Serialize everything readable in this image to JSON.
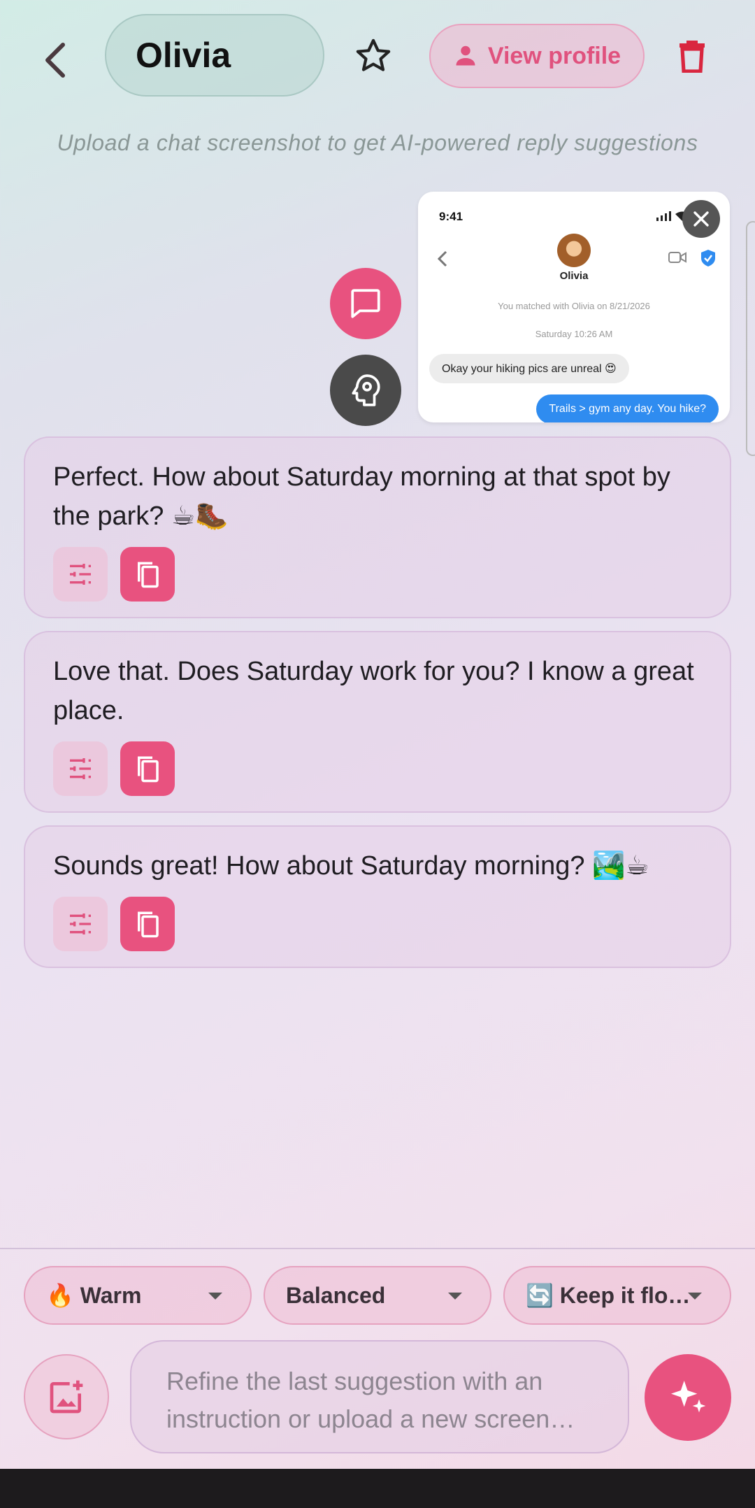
{
  "header": {
    "contact_name": "Olivia",
    "view_profile_label": "View profile"
  },
  "hint": "Upload a chat screenshot to get AI-powered reply suggestions",
  "screenshot_preview": {
    "time": "9:41",
    "contact_name": "Olivia",
    "matched_text": "You matched with Olivia on 8/21/2026",
    "date_text": "Saturday 10:26 AM",
    "incoming_message": "Okay your hiking pics are unreal 😍",
    "outgoing_message": "Trails > gym any day. You hike?"
  },
  "suggestions": [
    {
      "text": "Perfect. How about Saturday morning at that spot by the park? ☕🥾"
    },
    {
      "text": "Love that. Does Saturday work for you? I know a great place."
    },
    {
      "text": "Sounds great! How about Saturday morning? 🏞️☕"
    }
  ],
  "controls": {
    "tone": "🔥 Warm",
    "length": "Balanced",
    "goal": "🔄 Keep it flo…"
  },
  "composer": {
    "placeholder": "Refine the last suggestion with an instruction or upload a new screen…"
  },
  "colors": {
    "accent": "#e8527f",
    "accent_soft": "#f0b4cd",
    "dark_fab": "#4a4a4a"
  }
}
